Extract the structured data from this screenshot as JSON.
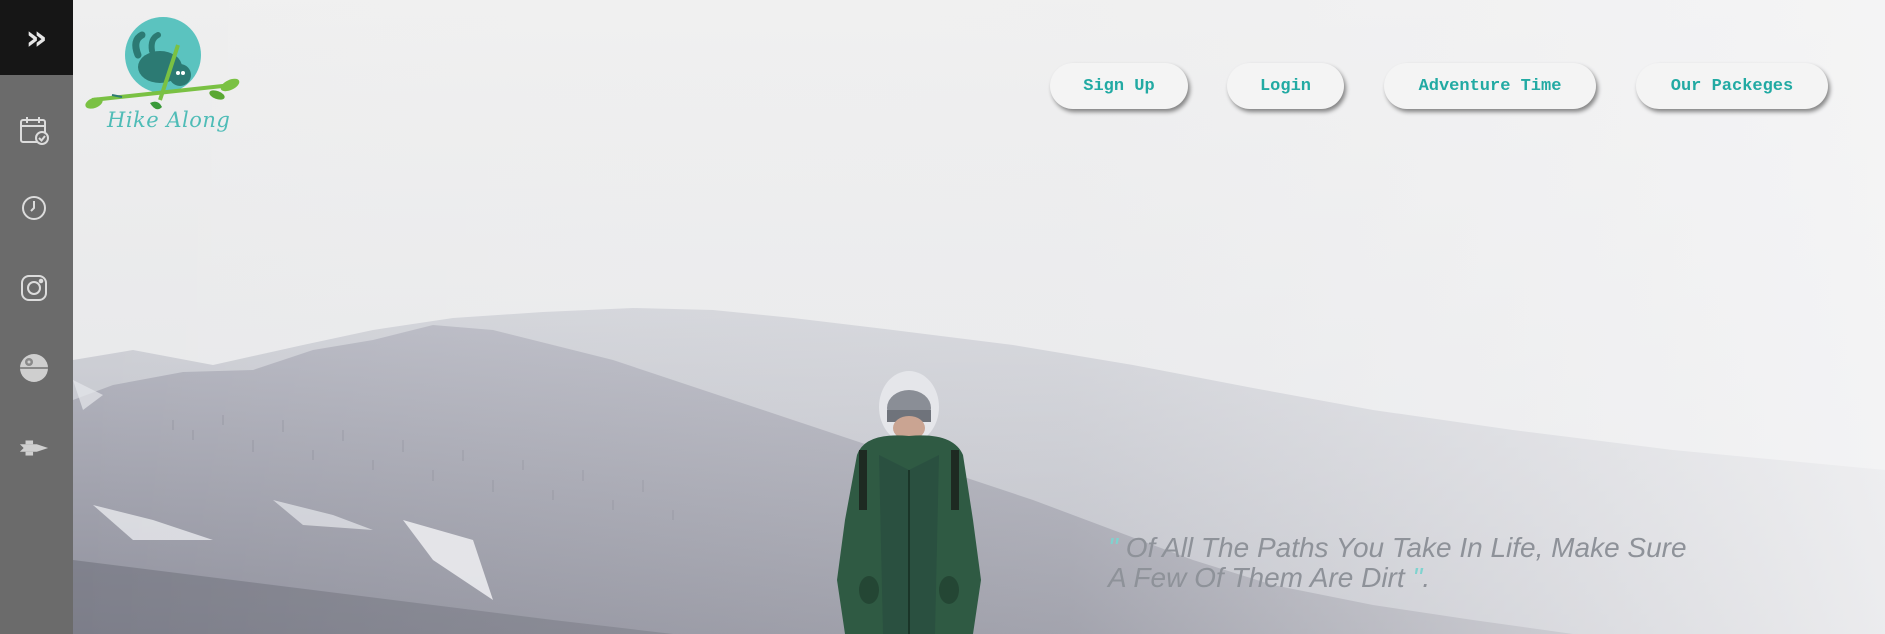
{
  "sidebar": {
    "toggle_icon": "double-chevron-right-icon",
    "items": [
      {
        "icon": "calendar-check-icon"
      },
      {
        "icon": "clock-icon"
      },
      {
        "icon": "instagram-icon"
      },
      {
        "icon": "death-star-icon"
      },
      {
        "icon": "spaceship-icon"
      }
    ]
  },
  "logo": {
    "text": "Hike Along",
    "icon": "sloth-on-branch-icon"
  },
  "nav": {
    "sign_up": "Sign Up",
    "login": "Login",
    "adventure_time": "Adventure Time",
    "our_packages": "Our Packeges"
  },
  "hero": {
    "quote_open": "\"",
    "quote_line1": " Of All The Paths You Take In Life, Make Sure",
    "quote_line2": "A Few Of Them Are Dirt ",
    "quote_close": "\"",
    "quote_end": "."
  },
  "colors": {
    "accent": "#22aaa3",
    "sidebar": "#6b6b6b",
    "sidebar_top": "#161616",
    "quote_text": "#8e9299"
  }
}
